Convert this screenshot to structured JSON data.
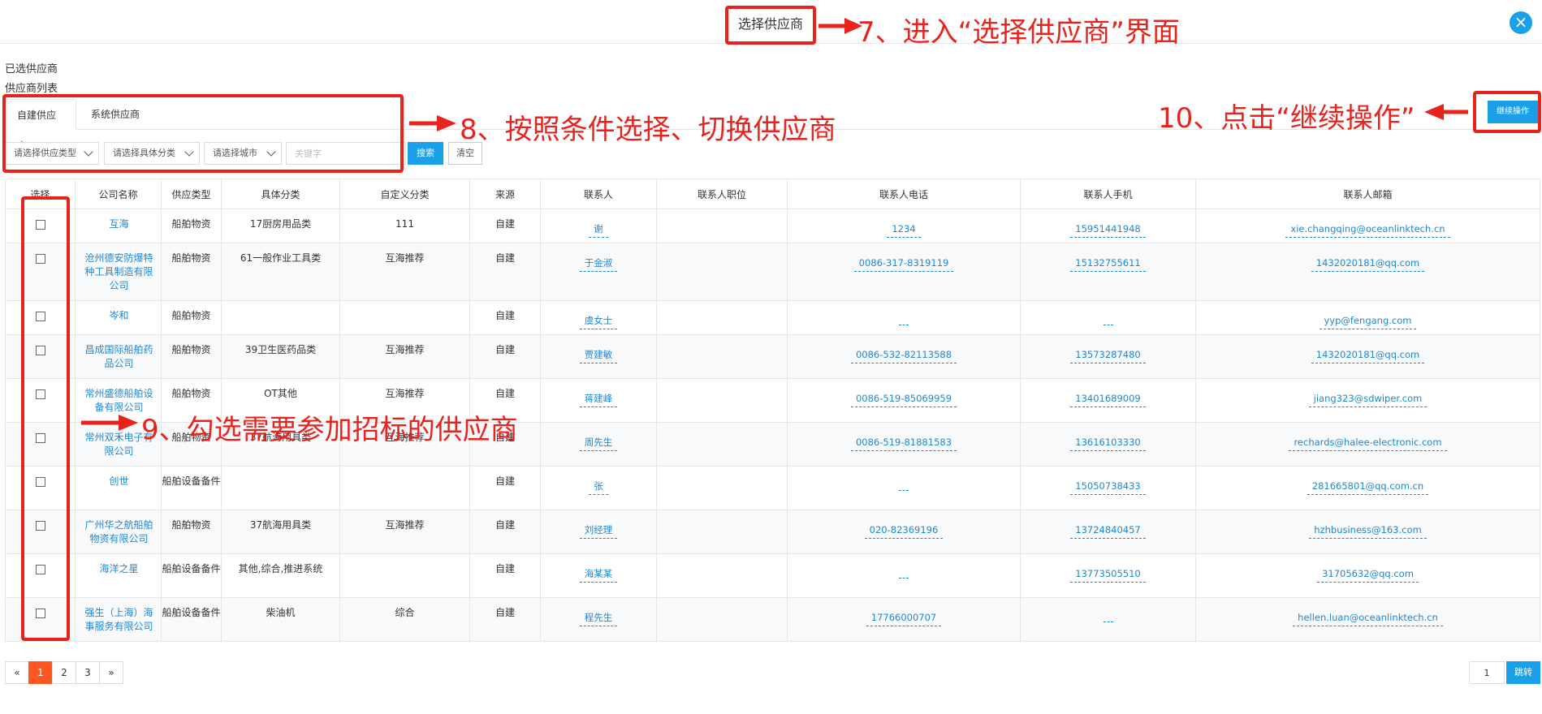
{
  "modal": {
    "title": "选择供应商",
    "close_label": "×"
  },
  "sections": {
    "selected": "已选供应商",
    "list": "供应商列表"
  },
  "tabs": [
    {
      "label": "自建供应商",
      "active": true
    },
    {
      "label": "系统供应商",
      "active": false
    }
  ],
  "filters": {
    "type": "请选择供应类型",
    "category": "请选择具体分类",
    "city": "请选择城市",
    "keyword_placeholder": "关键字",
    "search_label": "搜索",
    "clear_label": "清空"
  },
  "actions": {
    "continue_label": "继续操作"
  },
  "table": {
    "headers": [
      "选择",
      "公司名称",
      "供应类型",
      "具体分类",
      "自定义分类",
      "来源",
      "联系人",
      "联系人职位",
      "联系人电话",
      "联系人手机",
      "联系人邮箱"
    ],
    "rows": [
      {
        "company": "互海",
        "type": "船舶物资",
        "category": "17厨房用品类",
        "custom": "111",
        "source": "自建",
        "contact": "谢",
        "position": "",
        "phone": "1234",
        "mobile": "15951441948",
        "email": "xie.changqing@oceanlinktech.cn"
      },
      {
        "company": "沧州德安防爆特种工具制造有限公司",
        "type": "船舶物资",
        "category": "61一般作业工具类",
        "custom": "互海推荐",
        "source": "自建",
        "contact": "于金淑",
        "position": "",
        "phone": "0086-317-8319119",
        "mobile": "15132755611",
        "email": "1432020181@qq.com"
      },
      {
        "company": "岑和",
        "type": "船舶物资",
        "category": "",
        "custom": "",
        "source": "自建",
        "contact": "虞女士",
        "position": "",
        "phone": "",
        "mobile": "",
        "email": "yyp@fengang.com"
      },
      {
        "company": "昌成国际船舶药品公司",
        "type": "船舶物资",
        "category": "39卫生医药品类",
        "custom": "互海推荐",
        "source": "自建",
        "contact": "贾建敏",
        "position": "",
        "phone": "0086-532-82113588",
        "mobile": "13573287480",
        "email": "1432020181@qq.com"
      },
      {
        "company": "常州盛德船舶设备有限公司",
        "type": "船舶物资",
        "category": "OT其他",
        "custom": "互海推荐",
        "source": "自建",
        "contact": "蒋建峰",
        "position": "",
        "phone": "0086-519-85069959",
        "mobile": "13401689009",
        "email": "jiang323@sdwiper.com"
      },
      {
        "company": "常州双禾电子有限公司",
        "type": "船舶物资",
        "category": "37航海用具类",
        "custom": "互海推荐",
        "source": "自建",
        "contact": "周先生",
        "position": "",
        "phone": "0086-519-81881583",
        "mobile": "13616103330",
        "email": "rechards@halee-electronic.com"
      },
      {
        "company": "创世",
        "type": "船舶设备备件",
        "category": "",
        "custom": "",
        "source": "自建",
        "contact": "张",
        "position": "",
        "phone": "",
        "mobile": "15050738433",
        "email": "281665801@qq.com.cn"
      },
      {
        "company": "广州华之航船舶物资有限公司",
        "type": "船舶物资",
        "category": "37航海用具类",
        "custom": "互海推荐",
        "source": "自建",
        "contact": "刘经理",
        "position": "",
        "phone": "020-82369196",
        "mobile": "13724840457",
        "email": "hzhbusiness@163.com"
      },
      {
        "company": "海洋之星",
        "type": "船舶设备备件",
        "category": "其他,综合,推进系统",
        "custom": "",
        "source": "自建",
        "contact": "海某某",
        "position": "",
        "phone": "",
        "mobile": "13773505510",
        "email": "31705632@qq.com"
      },
      {
        "company": "强生（上海）海事服务有限公司",
        "type": "船舶设备备件",
        "category": "柴油机",
        "custom": "综合",
        "source": "自建",
        "contact": "程先生",
        "position": "",
        "phone": "17766000707",
        "mobile": "",
        "email": "hellen.luan@oceanlinktech.cn"
      }
    ]
  },
  "pagination": {
    "prev": "«",
    "pages": [
      "1",
      "2",
      "3"
    ],
    "current": "1",
    "next": "»",
    "jump_value": "1",
    "jump_label": "跳转"
  },
  "annotations": {
    "step7": "7、进入“选择供应商”界面",
    "step8": "8、按照条件选择、切换供应商",
    "step9": "9、勾选需要参加招标的供应商",
    "step10": "10、点击“继续操作”",
    "color": "#e8231e"
  }
}
